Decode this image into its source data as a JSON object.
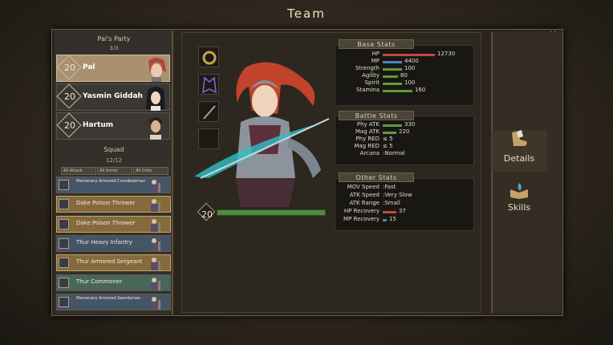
{
  "title": "Team",
  "party": {
    "title": "Pal's Party",
    "count": "3/3",
    "members": [
      {
        "level": "20",
        "name": "Pal",
        "selected": true
      },
      {
        "level": "20",
        "name": "Yasmin Giddah",
        "selected": false
      },
      {
        "level": "20",
        "name": "Hartum",
        "selected": false
      }
    ]
  },
  "squad": {
    "title": "Squad",
    "count": "12/12",
    "filters": [
      "All Attack",
      "All Armor",
      "All Units"
    ],
    "units": [
      {
        "name": "Mercenary Armored Crossbowman",
        "color": "blue",
        "small": true
      },
      {
        "name": "Dake Poison Thrower",
        "color": "gold",
        "small": false
      },
      {
        "name": "Dake Poison Thrower",
        "color": "gold",
        "small": false
      },
      {
        "name": "Thur Heavy Infantry",
        "color": "blue",
        "small": false
      },
      {
        "name": "Thur Armored Sergeant",
        "color": "gold",
        "small": false
      },
      {
        "name": "Thur Commoner",
        "color": "green",
        "small": false
      },
      {
        "name": "Mercenary Armored Swordsman",
        "color": "blue",
        "small": true
      }
    ]
  },
  "hero": {
    "level": "20"
  },
  "base_stats": {
    "title": "Base Stats",
    "rows": [
      {
        "label": "HP",
        "value": "12730",
        "fill": 0.95,
        "color": "#c04a3a"
      },
      {
        "label": "MP",
        "value": "4400",
        "fill": 0.35,
        "color": "#4b86c4"
      },
      {
        "label": "Strength",
        "value": "100",
        "fill": 0.35,
        "color": "#5e9a3c"
      },
      {
        "label": "Agility",
        "value": "80",
        "fill": 0.28,
        "color": "#5e9a3c"
      },
      {
        "label": "Spirit",
        "value": "100",
        "fill": 0.35,
        "color": "#5e9a3c"
      },
      {
        "label": "Stamina",
        "value": "160",
        "fill": 0.55,
        "color": "#5e9a3c"
      }
    ]
  },
  "battle_stats": {
    "title": "Battle Stats",
    "rows": [
      {
        "label": "Phy ATK",
        "value": "330",
        "fill": 0.35,
        "color": "#5e9a3c"
      },
      {
        "label": "Mag ATK",
        "value": "220",
        "fill": 0.25,
        "color": "#5e9a3c"
      },
      {
        "label": "Phy RED",
        "value": "≤ 5",
        "fill": 0
      },
      {
        "label": "Mag RED",
        "value": "≤ 5",
        "fill": 0
      },
      {
        "label": "Arcana",
        "value": ":Normal",
        "fill": 0
      }
    ]
  },
  "other_stats": {
    "title": "Other Stats",
    "rows": [
      {
        "label": "MOV Speed",
        "value": ":Fast",
        "fill": 0
      },
      {
        "label": "ATK Speed",
        "value": ":Very Slow",
        "fill": 0
      },
      {
        "label": "ATK Range",
        "value": ":Small",
        "fill": 0
      },
      {
        "label": "HP Recovery",
        "value": "37",
        "fill": 0.25,
        "color": "#c04a3a"
      },
      {
        "label": "MP Recovery",
        "value": "15",
        "fill": 0.08,
        "color": "#4b86c4"
      }
    ]
  },
  "nav": {
    "details": "Details",
    "skills": "Skills"
  },
  "colors": {
    "accent_gold": "#c4a464",
    "selected_card": "#a99071",
    "level_bar": "#4f8c3c"
  }
}
